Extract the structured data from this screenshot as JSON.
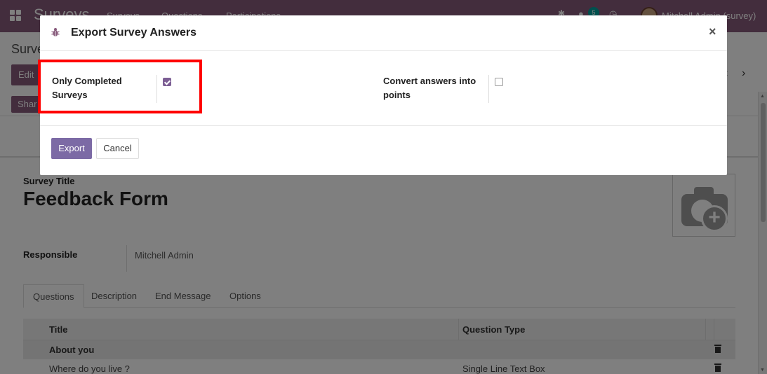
{
  "navbar": {
    "app_name": "Surveys",
    "menu": [
      "Surveys",
      "Questions",
      "Participations"
    ],
    "chat_count": "5",
    "user": "Mitchell Admin (survey)"
  },
  "control_panel": {
    "breadcrumb": "Surve",
    "edit_label": "Edit",
    "share_label": "Shar"
  },
  "form": {
    "title_label": "Survey Title",
    "title_value": "Feedback Form",
    "responsible_label": "Responsible",
    "responsible_value": "Mitchell Admin",
    "tabs": [
      "Questions",
      "Description",
      "End Message",
      "Options"
    ],
    "table": {
      "headers": [
        "Title",
        "Question Type"
      ],
      "rows": [
        {
          "title": "About you",
          "type": "",
          "section": true
        },
        {
          "title": "Where do you live ?",
          "type": "Single Line Text Box",
          "section": false
        }
      ]
    }
  },
  "modal": {
    "title": "Export Survey Answers",
    "close_glyph": "×",
    "options": [
      {
        "label_line1": "Only Completed",
        "label_line2": "Surveys",
        "checked": true
      },
      {
        "label_line1": "Convert answers into",
        "label_line2": "points",
        "checked": false
      }
    ],
    "export_label": "Export",
    "cancel_label": "Cancel"
  },
  "colors": {
    "brand": "#875a7b",
    "primary_button": "#7c6aa5",
    "highlight": "#ff0000"
  }
}
